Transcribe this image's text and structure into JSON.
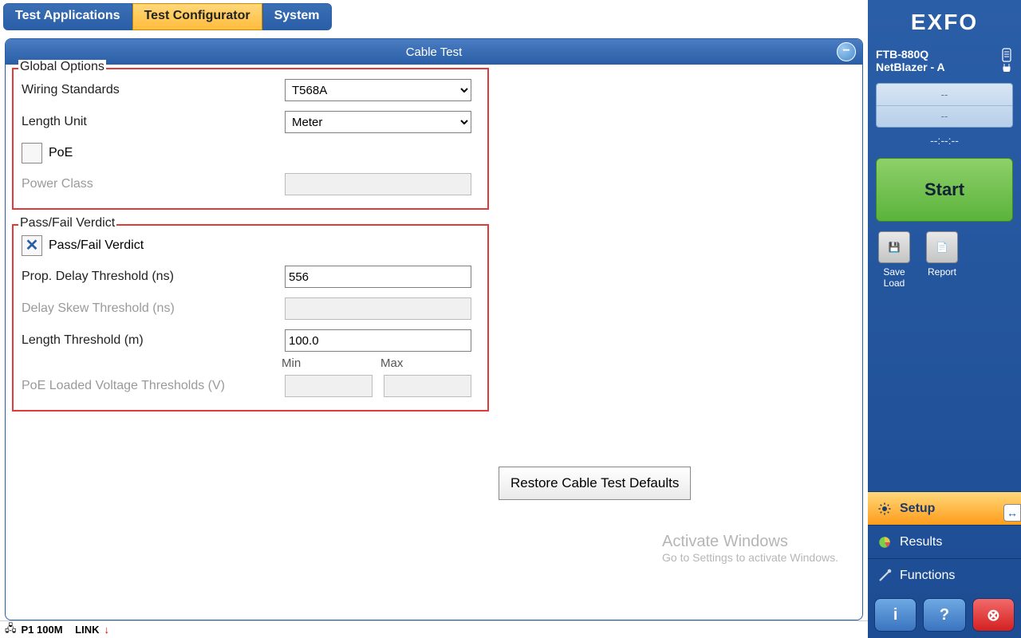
{
  "tabs": {
    "apps": "Test Applications",
    "config": "Test Configurator",
    "system": "System"
  },
  "page": {
    "title": "Cable Test"
  },
  "global": {
    "legend": "Global Options",
    "wiring_label": "Wiring Standards",
    "wiring_value": "T568A",
    "length_unit_label": "Length Unit",
    "length_unit_value": "Meter",
    "poe_label": "PoE",
    "poe_checked": false,
    "power_class_label": "Power Class",
    "power_class_value": ""
  },
  "verdict": {
    "legend": "Pass/Fail Verdict",
    "pf_label": "Pass/Fail Verdict",
    "pf_checked": true,
    "prop_delay_label": "Prop. Delay Threshold (ns)",
    "prop_delay_value": "556",
    "delay_skew_label": "Delay Skew Threshold (ns)",
    "delay_skew_value": "",
    "length_thr_label": "Length Threshold (m)",
    "length_thr_value": "100.0",
    "min_label": "Min",
    "max_label": "Max",
    "poe_volt_label": "PoE Loaded Voltage Thresholds (V)",
    "poe_volt_min": "",
    "poe_volt_max": ""
  },
  "restore_label": "Restore Cable Test Defaults",
  "status": {
    "port": "P1 100M",
    "link": "LINK",
    "link_arrow": "↓"
  },
  "side": {
    "logo": "EXFO",
    "model": "FTB-880Q",
    "app": "NetBlazer  - A",
    "mini1": "--",
    "mini2": "--",
    "clock": "--:--:--",
    "start": "Start",
    "save_load": "Save\nLoad",
    "report": "Report",
    "nav_setup": "Setup",
    "nav_results": "Results",
    "nav_functions": "Functions"
  },
  "watermark": {
    "title": "Activate Windows",
    "sub": "Go to Settings to activate Windows."
  }
}
